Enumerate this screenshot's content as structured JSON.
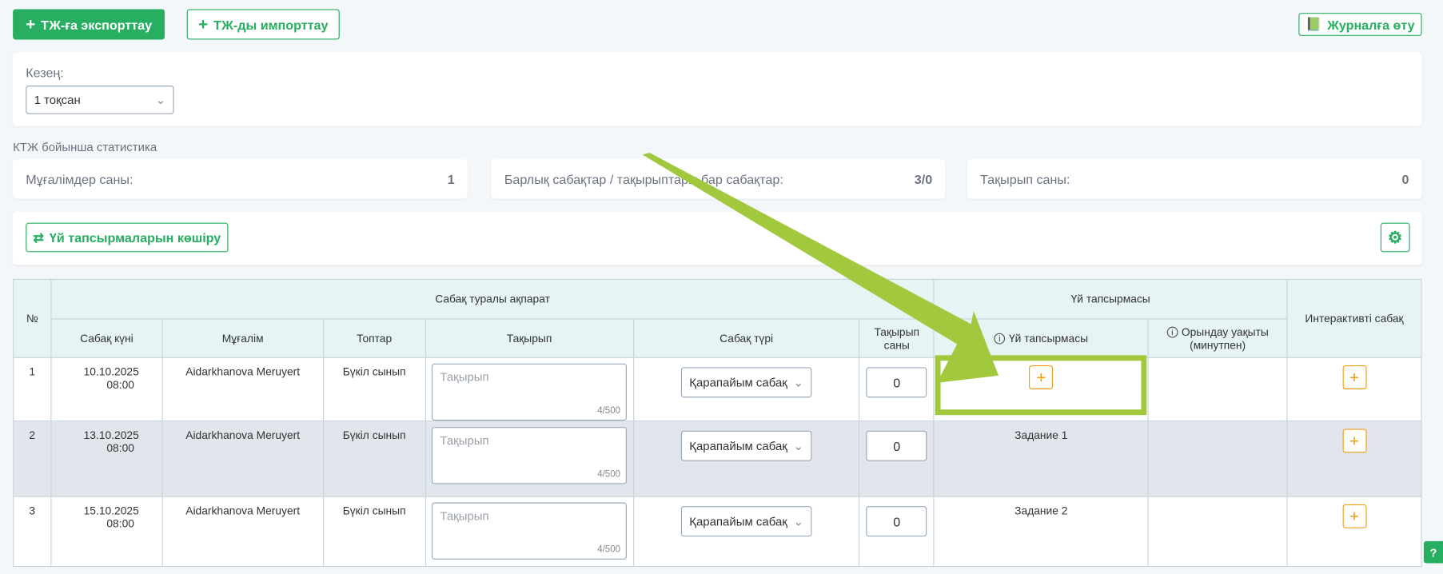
{
  "toolbar": {
    "export_label": "ТЖ-ға экспорттау",
    "import_label": "ТЖ-ды импорттау",
    "journal_label": "Журналға өту"
  },
  "period": {
    "label": "Кезең:",
    "value": "1 тоқсан"
  },
  "stats": {
    "title": "КТЖ бойынша статистика",
    "items": [
      {
        "label": "Мұғалімдер саны:",
        "value": "1"
      },
      {
        "label": "Барлық сабақтар / тақырыптары бар сабақтар:",
        "value": "3/0"
      },
      {
        "label": "Тақырып саны:",
        "value": "0"
      }
    ]
  },
  "copy_label": "Үй тапсырмаларын көшіру",
  "table": {
    "h_no": "№",
    "h_info": "Сабақ туралы ақпарат",
    "h_hw": "Үй тапсырмасы",
    "h_interactive": "Интерактивті сабақ",
    "h_date": "Сабақ күні",
    "h_teacher": "Мұғалім",
    "h_groups": "Топтар",
    "h_topic": "Тақырып",
    "h_type": "Сабақ түрі",
    "h_count": "Тақырып саны",
    "h_hw_sub": "Үй тапсырмасы",
    "h_time": "Орындау уақыты (минутпен)",
    "rows": [
      {
        "no": "1",
        "date": "10.10.2025",
        "time": "08:00",
        "teacher": "Aidarkhanova Meruyert",
        "group": "Бүкіл сынып",
        "topic_placeholder": "Тақырып",
        "counter": "4/500",
        "type": "Қарапайым сабақ",
        "count": "0",
        "hw": ""
      },
      {
        "no": "2",
        "date": "13.10.2025",
        "time": "08:00",
        "teacher": "Aidarkhanova Meruyert",
        "group": "Бүкіл сынып",
        "topic_placeholder": "Тақырып",
        "counter": "4/500",
        "type": "Қарапайым сабақ",
        "count": "0",
        "hw": "Задание 1"
      },
      {
        "no": "3",
        "date": "15.10.2025",
        "time": "08:00",
        "teacher": "Aidarkhanova Meruyert",
        "group": "Бүкіл сынып",
        "topic_placeholder": "Тақырып",
        "counter": "4/500",
        "type": "Қарапайым сабақ",
        "count": "0",
        "hw": "Задание 2"
      }
    ]
  },
  "colors": {
    "primary": "#27ae60",
    "accent": "#f39c12",
    "annotation": "#a2c83e"
  }
}
